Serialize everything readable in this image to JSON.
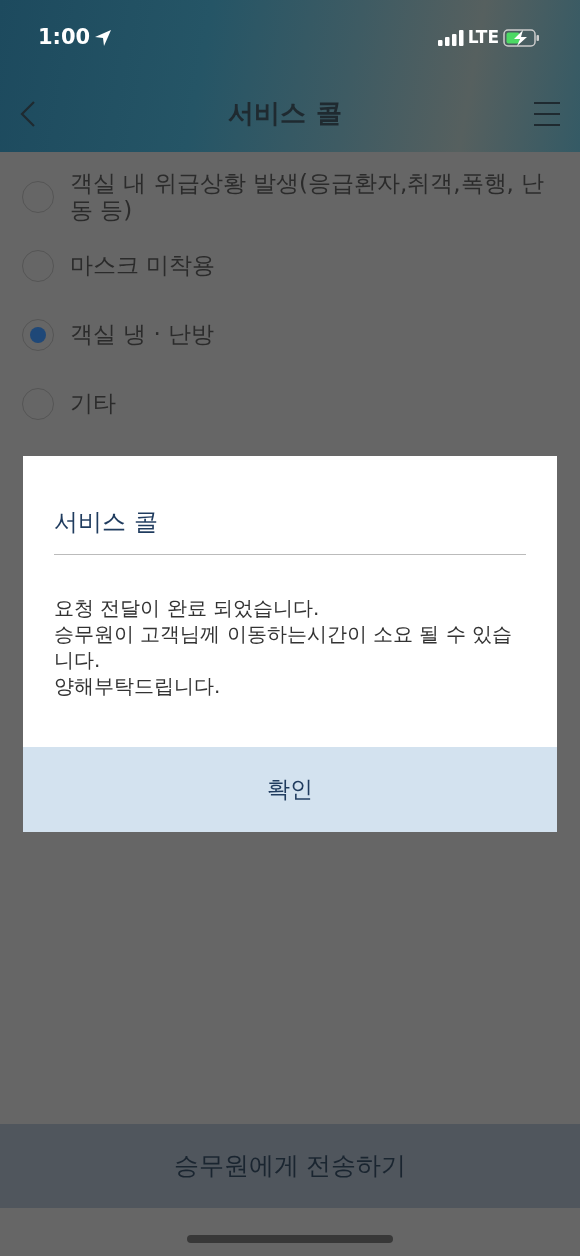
{
  "status_bar": {
    "time": "1:00",
    "network": "LTE"
  },
  "header": {
    "title": "서비스 콜"
  },
  "options": [
    {
      "label": "객실 내 위급상황 발생(응급환자,취객,폭행, 난동 등)",
      "selected": false
    },
    {
      "label": "마스크 미착용",
      "selected": false
    },
    {
      "label": "객실 냉 · 난방",
      "selected": true
    },
    {
      "label": "기타",
      "selected": false
    }
  ],
  "dialog": {
    "title": "서비스 콜",
    "message": [
      "요청 전달이 완료 되었습니다.",
      "승무원이 고객님께 이동하는시간이 소요 될 수 있습니다.",
      "양해부탁드립니다."
    ],
    "button": "확인"
  },
  "send_button": "승무원에게 전송하기"
}
